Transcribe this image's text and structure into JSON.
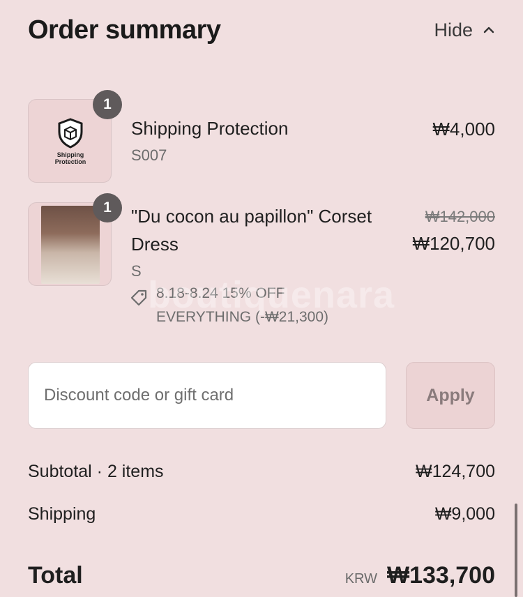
{
  "header": {
    "title": "Order summary",
    "toggle_label": "Hide"
  },
  "items": [
    {
      "quantity": "1",
      "thumb_text": "Shipping\nProtection",
      "name": "Shipping Protection",
      "variant": "S007",
      "price": "₩4,000"
    },
    {
      "quantity": "1",
      "name_line1": "\"Du cocon au papillon\" Corset",
      "name_line2": "Dress",
      "variant": "S",
      "original_price": "₩142,000",
      "price": "₩120,700",
      "discount_line1": "8.18-8.24 15% OFF",
      "discount_line2": "EVERYTHING (-₩21,300)"
    }
  ],
  "discount_field": {
    "placeholder": "Discount code or gift card",
    "button_label": "Apply"
  },
  "summary": {
    "subtotal_label": "Subtotal · 2 items",
    "subtotal_value": "₩124,700",
    "shipping_label": "Shipping",
    "shipping_value": "₩9,000",
    "total_label": "Total",
    "currency": "KRW",
    "total_value": "₩133,700"
  },
  "watermark": "boutiquenara",
  "colors": {
    "background": "#f1dfe0",
    "badge": "#5f5a5b",
    "input_bg": "#ffffff",
    "button_bg": "#ecd3d4"
  }
}
